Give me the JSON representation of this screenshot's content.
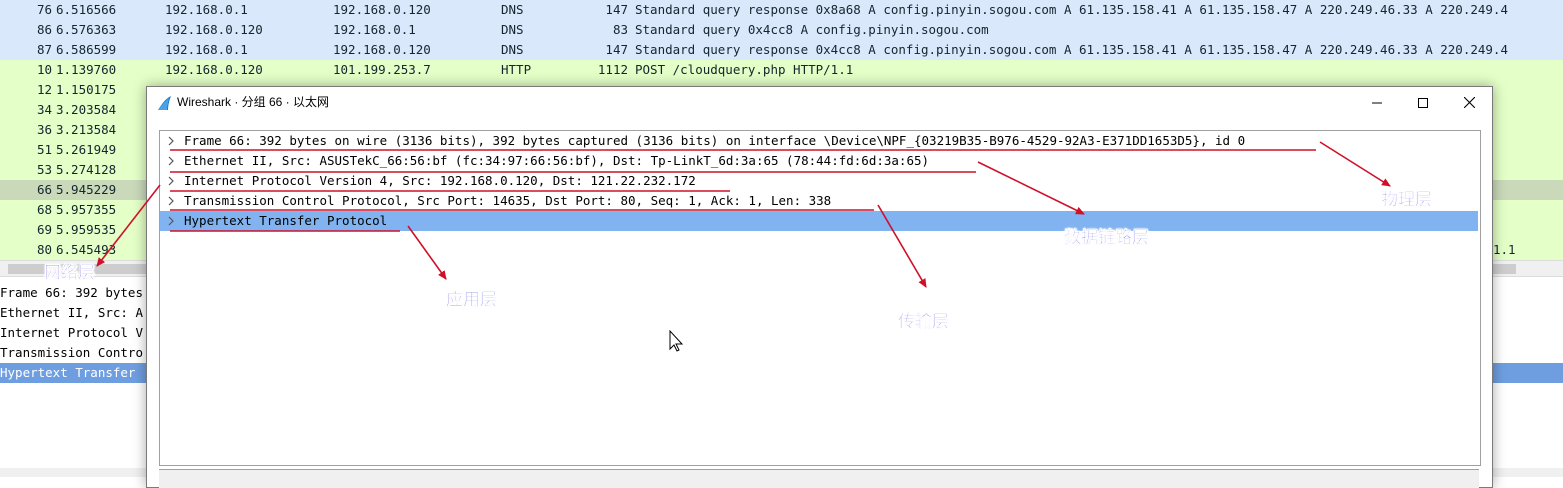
{
  "packet_list": {
    "rows": [
      {
        "no": "76",
        "time": "6.516566",
        "src": "192.168.0.1",
        "dst": "192.168.0.120",
        "proto": "DNS",
        "len": "147",
        "info": "Standard query response 0x8a68 A config.pinyin.sogou.com A 61.135.158.41 A 61.135.158.47 A 220.249.46.33 A 220.249.4",
        "bg": "#dae8fc"
      },
      {
        "no": "86",
        "time": "6.576363",
        "src": "192.168.0.120",
        "dst": "192.168.0.1",
        "proto": "DNS",
        "len": "83",
        "info": "Standard query 0x4cc8 A config.pinyin.sogou.com",
        "bg": "#dae8fc"
      },
      {
        "no": "87",
        "time": "6.586599",
        "src": "192.168.0.1",
        "dst": "192.168.0.120",
        "proto": "DNS",
        "len": "147",
        "info": "Standard query response 0x4cc8 A config.pinyin.sogou.com A 61.135.158.41 A 61.135.158.47 A 220.249.46.33 A 220.249.4",
        "bg": "#dae8fc"
      },
      {
        "no": "10",
        "time": "1.139760",
        "src": "192.168.0.120",
        "dst": "101.199.253.7",
        "proto": "HTTP",
        "len": "1112",
        "info": "POST /cloudquery.php HTTP/1.1",
        "bg": "#e4ffc7"
      },
      {
        "no": "12",
        "time": "1.150175",
        "src": "",
        "dst": "",
        "proto": "",
        "len": "",
        "info": "",
        "bg": "#e4ffc7"
      },
      {
        "no": "34",
        "time": "3.203584",
        "src": "",
        "dst": "",
        "proto": "",
        "len": "",
        "info": "",
        "bg": "#e4ffc7"
      },
      {
        "no": "36",
        "time": "3.213584",
        "src": "",
        "dst": "",
        "proto": "",
        "len": "",
        "info": "",
        "bg": "#e4ffc7"
      },
      {
        "no": "51",
        "time": "5.261949",
        "src": "",
        "dst": "",
        "proto": "",
        "len": "",
        "info": "",
        "bg": "#e4ffc7"
      },
      {
        "no": "53",
        "time": "5.274128",
        "src": "",
        "dst": "",
        "proto": "",
        "len": "",
        "info": "",
        "bg": "#e4ffc7"
      },
      {
        "no": "66",
        "time": "5.945229",
        "src": "",
        "dst": "",
        "proto": "",
        "len": "",
        "info": "",
        "bg": "#c9d9b9"
      },
      {
        "no": "68",
        "time": "5.957355",
        "src": "",
        "dst": "",
        "proto": "",
        "len": "",
        "info": "",
        "bg": "#e4ffc7"
      },
      {
        "no": "69",
        "time": "5.959535",
        "src": "",
        "dst": "",
        "proto": "",
        "len": "",
        "info": "",
        "bg": "#e4ffc7"
      },
      {
        "no": "80",
        "time": "6.545493",
        "src": "",
        "dst": "",
        "proto": "",
        "len": "",
        "info": "",
        "bg": "#e4ffc7"
      }
    ],
    "row_80_tail": "1.1"
  },
  "details_pane": {
    "rows": [
      {
        "text": "Frame 66: 392 bytes",
        "selected": false
      },
      {
        "text": "Ethernet II, Src: A",
        "selected": false
      },
      {
        "text": "Internet Protocol V",
        "selected": false
      },
      {
        "text": "Transmission Contro",
        "selected": false
      },
      {
        "text": "Hypertext Transfer",
        "selected": true
      }
    ]
  },
  "dialog": {
    "title": "Wireshark · 分组 66 · 以太网",
    "tree": [
      {
        "text": "Frame 66: 392 bytes on wire (3136 bits), 392 bytes captured (3136 bits) on interface \\Device\\NPF_{03219B35-B976-4529-92A3-E371DD1653D5}, id 0",
        "selected": false
      },
      {
        "text": "Ethernet II, Src: ASUSTekC_66:56:bf (fc:34:97:66:56:bf), Dst: Tp-LinkT_6d:3a:65 (78:44:fd:6d:3a:65)",
        "selected": false
      },
      {
        "text": "Internet Protocol Version 4, Src: 192.168.0.120, Dst: 121.22.232.172",
        "selected": false
      },
      {
        "text": "Transmission Control Protocol, Src Port: 14635, Dst Port: 80, Seq: 1, Ack: 1, Len: 338",
        "selected": false
      },
      {
        "text": "Hypertext Transfer Protocol",
        "selected": true
      }
    ]
  },
  "annotations": {
    "physical_layer": "物理层",
    "data_link_layer": "数据链路层",
    "network_layer": "网络层",
    "application_layer": "应用层",
    "transport_layer": "传输层"
  },
  "colors": {
    "dns_row": "#dae8fc",
    "http_row": "#e4ffc7",
    "selected_packet_row": "#c9d9b9",
    "tree_selection": "#81b3f0",
    "annotation_line": "#d0102a",
    "annotation_text": "#3a2fd8"
  },
  "icons": [
    "wireshark-fin-icon",
    "minimize-icon",
    "maximize-icon",
    "close-icon",
    "chevron-right-icon",
    "mouse-cursor-icon"
  ]
}
